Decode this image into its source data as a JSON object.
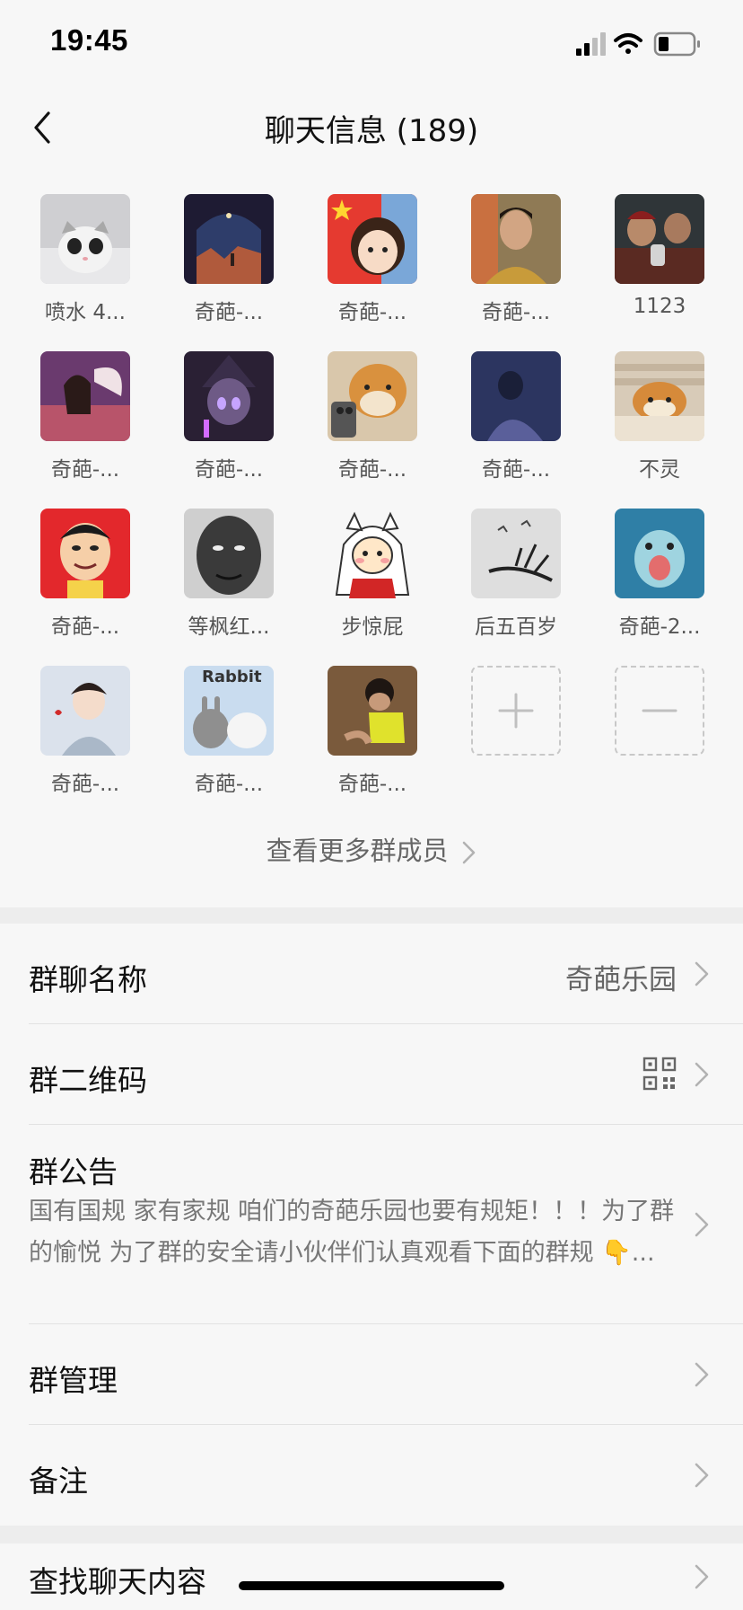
{
  "status_bar": {
    "time": "19:45"
  },
  "nav": {
    "title": "聊天信息 (189)"
  },
  "members": [
    {
      "name": "喷水 4...",
      "avatar": "cat-avatar"
    },
    {
      "name": "奇葩-...",
      "avatar": "night-window-avatar"
    },
    {
      "name": "奇葩-...",
      "avatar": "flag-girl-avatar"
    },
    {
      "name": "奇葩-...",
      "avatar": "man-portrait-avatar"
    },
    {
      "name": "1123",
      "avatar": "movie-scene-avatar"
    },
    {
      "name": "奇葩-...",
      "avatar": "angel-woman-avatar"
    },
    {
      "name": "奇葩-...",
      "avatar": "anime-witch-avatar"
    },
    {
      "name": "奇葩-...",
      "avatar": "shiba-phone-avatar"
    },
    {
      "name": "奇葩-...",
      "avatar": "blue-person-avatar"
    },
    {
      "name": "不灵",
      "avatar": "shiba-blanket-avatar"
    },
    {
      "name": "奇葩-...",
      "avatar": "cartoon-face-avatar"
    },
    {
      "name": "等枫红...",
      "avatar": "bw-man-avatar"
    },
    {
      "name": "步惊屁",
      "avatar": "inuyasha-dog-avatar"
    },
    {
      "name": "后五百岁",
      "avatar": "ink-branch-avatar"
    },
    {
      "name": "奇葩-2...",
      "avatar": "blue-bird-avatar"
    },
    {
      "name": "奇葩-...",
      "avatar": "boy-illustration-avatar"
    },
    {
      "name": "奇葩-...",
      "avatar": "rabbit-avatar"
    },
    {
      "name": "奇葩-...",
      "avatar": "child-photo-avatar"
    }
  ],
  "member_actions": {
    "add_icon": "plus-icon",
    "remove_icon": "minus-icon"
  },
  "view_more": {
    "label": "查看更多群成员"
  },
  "settings": {
    "group_name": {
      "label": "群聊名称",
      "value": "奇葩乐园"
    },
    "qr_code": {
      "label": "群二维码",
      "icon": "qr-code-icon"
    },
    "notice": {
      "label": "群公告",
      "text": "国有国规 家有家规 咱们的奇葩乐园也要有规矩！！！为了群的愉悦 为了群的安全请小伙伴们认真观看下面的群规 👇..."
    },
    "manage": {
      "label": "群管理"
    },
    "remark": {
      "label": "备注"
    },
    "search": {
      "label": "查找聊天内容"
    }
  },
  "colors": {
    "background": "#ededed",
    "panel": "#f7f7f7",
    "text_primary": "#111111",
    "text_secondary": "#666666",
    "chevron": "#b2b2b2"
  }
}
